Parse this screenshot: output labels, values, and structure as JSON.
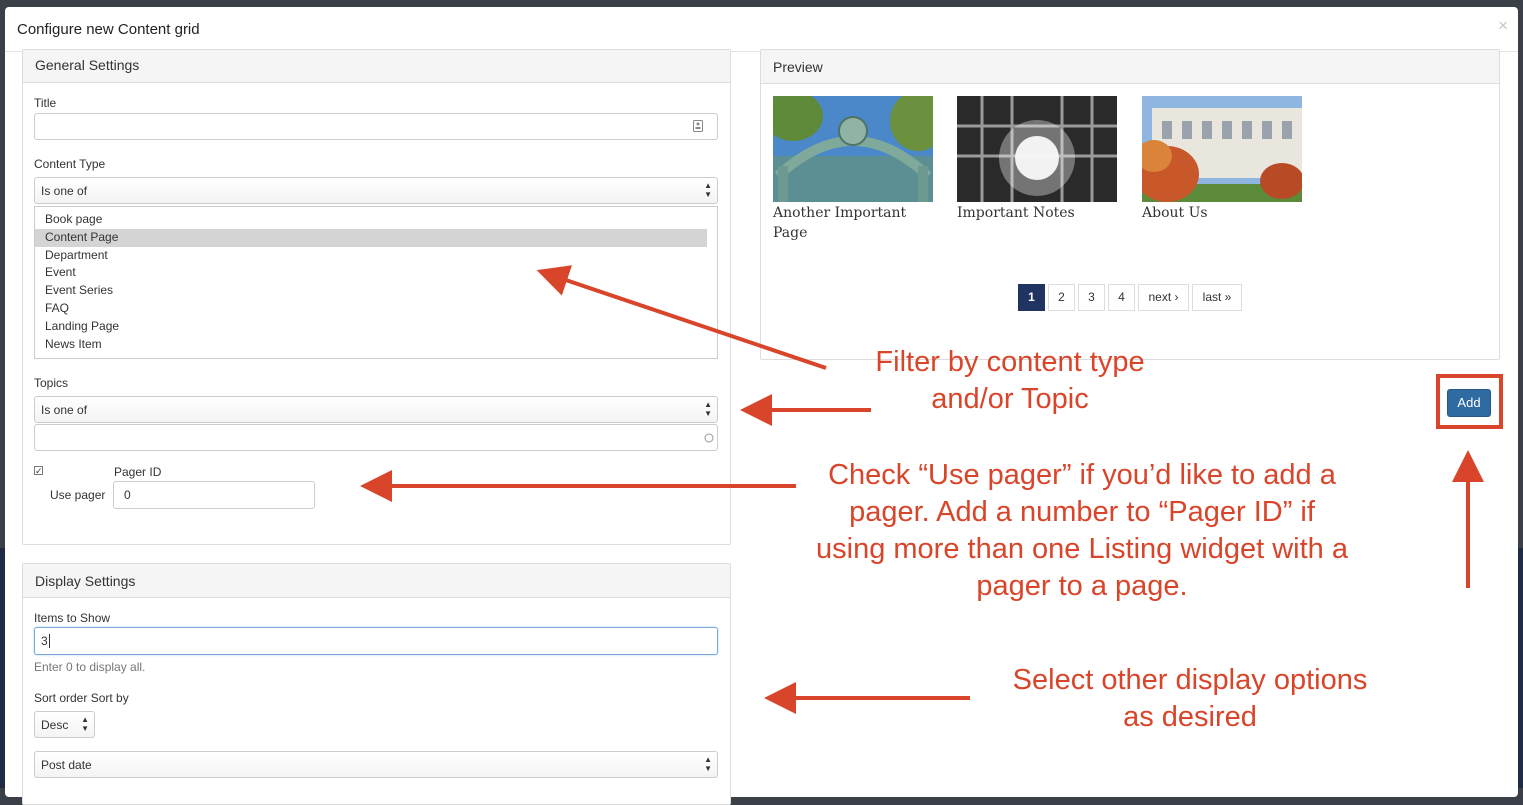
{
  "modal": {
    "title": "Configure new Content grid",
    "close": "×"
  },
  "general": {
    "heading": "General Settings",
    "title_label": "Title",
    "title_value": "",
    "content_type_label": "Content Type",
    "content_type_operator": "Is one of",
    "content_types": [
      {
        "label": "Book page",
        "selected": false
      },
      {
        "label": "Content Page",
        "selected": true
      },
      {
        "label": "Department",
        "selected": false
      },
      {
        "label": "Event",
        "selected": false
      },
      {
        "label": "Event Series",
        "selected": false
      },
      {
        "label": "FAQ",
        "selected": false
      },
      {
        "label": "Landing Page",
        "selected": false
      },
      {
        "label": "News Item",
        "selected": false
      }
    ],
    "topics_label": "Topics",
    "topics_operator": "Is one of",
    "topics_value": "",
    "use_pager_label": "Use pager",
    "use_pager_checked": true,
    "pager_id_label": "Pager ID",
    "pager_id_value": "0"
  },
  "display": {
    "heading": "Display Settings",
    "items_label": "Items to Show",
    "items_value": "3",
    "items_help": "Enter 0 to display all.",
    "sort_label": "Sort order Sort by",
    "sort_order": "Desc",
    "sort_by": "Post date"
  },
  "preview": {
    "heading": "Preview",
    "items": [
      {
        "caption": "Another Important Page"
      },
      {
        "caption": "Important Notes"
      },
      {
        "caption": "About Us"
      }
    ],
    "pager": {
      "pages": [
        "1",
        "2",
        "3",
        "4"
      ],
      "active_page": "1",
      "next": "next ›",
      "last": "last »"
    }
  },
  "add_button": "Add",
  "annotations": {
    "filter": [
      "Filter by content type",
      "and/or Topic"
    ],
    "pager": [
      "Check “Use pager” if you’d like to add a",
      "pager. Add a number to “Pager ID” if",
      "using more than one Listing widget with a",
      "pager to a page."
    ],
    "display": [
      "Select other display options",
      "as desired"
    ],
    "color": "#d9452a"
  }
}
